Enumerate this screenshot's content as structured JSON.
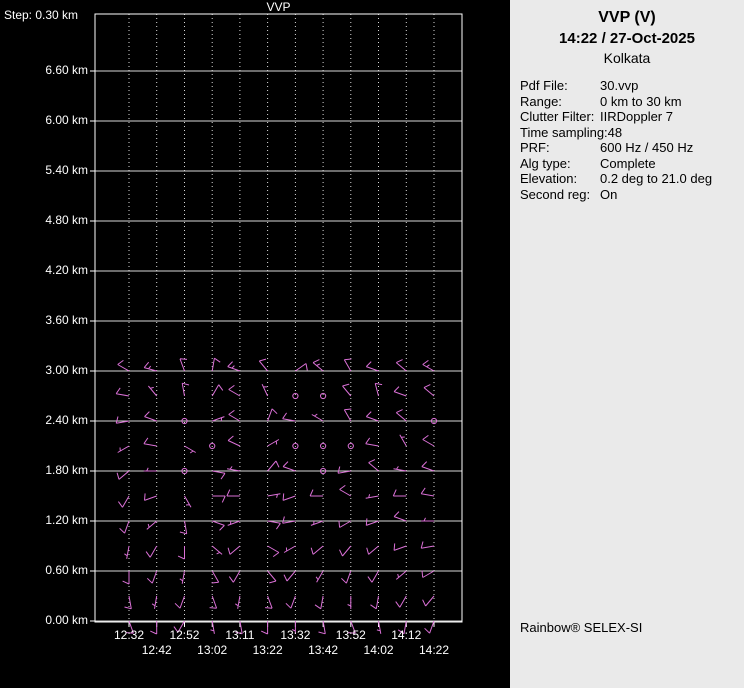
{
  "colors": {
    "background": "#000000",
    "grid": "#d9d9d9",
    "border": "#ffffff",
    "barbs": "#da70d6",
    "panel_bg": "#eaeaea",
    "chart_text": "#ffffff",
    "panel_text": "#000000"
  },
  "panel": {
    "title": "VVP (V)",
    "datetime": "14:22 / 27-Oct-2025",
    "site": "Kolkata",
    "fields": [
      {
        "label": "Pdf File:",
        "value": "30.vvp"
      },
      {
        "label": "Range:",
        "value": "0 km to 30 km"
      },
      {
        "label": "Clutter Filter:",
        "value": "IIRDoppler 7"
      },
      {
        "label": "Time sampling:",
        "value": "48"
      },
      {
        "label": "PRF:",
        "value": "600 Hz / 450 Hz"
      },
      {
        "label": "Alg type:",
        "value": "Complete"
      },
      {
        "label": "Elevation:",
        "value": "0.2 deg to 21.0 deg"
      },
      {
        "label": "Second reg:",
        "value": "On"
      }
    ],
    "footer": "Rainbow® SELEX-SI"
  },
  "chart_data": {
    "type": "wind-barb-time-height",
    "title": "VVP",
    "step_label": "Step: 0.30 km",
    "x_ticks": [
      "12:32",
      "12:42",
      "12:52",
      "13:02",
      "13:11",
      "13:22",
      "13:32",
      "13:42",
      "13:52",
      "14:02",
      "14:12",
      "14:22"
    ],
    "y_ticks_km": [
      6.6,
      6.0,
      5.4,
      4.8,
      4.2,
      3.6,
      3.0,
      2.4,
      1.8,
      1.2,
      0.6,
      0.0
    ],
    "y_tick_labels": [
      "6.60 km",
      "6.00 km",
      "5.40 km",
      "4.80 km",
      "4.20 km",
      "3.60 km",
      "3.00 km",
      "2.40 km",
      "1.80 km",
      "1.20 km",
      "0.60 km",
      "0.00 km"
    ],
    "y_unit": "km",
    "ylim_km": [
      0.0,
      7.3
    ],
    "grid": {
      "horizontal": "solid",
      "vertical": "dotted"
    },
    "barb_color": "#da70d6",
    "barb_units": "kt",
    "barb_note": "each barb = [wind_direction_deg_from, wind_speed_kt]; [0,0] = calm (circle)",
    "series": [
      {
        "height_km": 3.0,
        "barbs": [
          [
            300,
            10
          ],
          [
            285,
            15
          ],
          [
            340,
            10
          ],
          [
            10,
            10
          ],
          [
            290,
            15
          ],
          [
            320,
            10
          ],
          [
            55,
            10
          ],
          [
            310,
            15
          ],
          [
            330,
            10
          ],
          [
            290,
            10
          ],
          [
            310,
            10
          ],
          [
            300,
            15
          ]
        ]
      },
      {
        "height_km": 2.7,
        "barbs": [
          [
            280,
            10
          ],
          [
            320,
            5
          ],
          [
            350,
            10
          ],
          [
            30,
            10
          ],
          [
            300,
            10
          ],
          [
            335,
            5
          ],
          [
            0,
            0
          ],
          [
            0,
            0
          ],
          [
            320,
            10
          ],
          [
            345,
            10
          ],
          [
            290,
            10
          ],
          [
            310,
            10
          ]
        ]
      },
      {
        "height_km": 2.4,
        "barbs": [
          [
            260,
            10
          ],
          [
            290,
            10
          ],
          [
            0,
            0
          ],
          [
            70,
            5
          ],
          [
            300,
            10
          ],
          [
            20,
            10
          ],
          [
            280,
            10
          ],
          [
            300,
            5
          ],
          [
            330,
            10
          ],
          [
            290,
            10
          ],
          [
            310,
            10
          ],
          [
            0,
            0
          ]
        ]
      },
      {
        "height_km": 2.1,
        "barbs": [
          [
            240,
            5
          ],
          [
            280,
            10
          ],
          [
            120,
            5
          ],
          [
            0,
            0
          ],
          [
            295,
            10
          ],
          [
            60,
            5
          ],
          [
            0,
            0
          ],
          [
            0,
            0
          ],
          [
            0,
            0
          ],
          [
            280,
            10
          ],
          [
            330,
            5
          ],
          [
            300,
            10
          ]
        ]
      },
      {
        "height_km": 1.8,
        "barbs": [
          [
            230,
            10
          ],
          [
            270,
            5
          ],
          [
            0,
            0
          ],
          [
            100,
            10
          ],
          [
            280,
            5
          ],
          [
            40,
            10
          ],
          [
            290,
            10
          ],
          [
            0,
            0
          ],
          [
            260,
            10
          ],
          [
            310,
            10
          ],
          [
            280,
            5
          ],
          [
            290,
            10
          ]
        ]
      },
      {
        "height_km": 1.5,
        "barbs": [
          [
            210,
            10
          ],
          [
            250,
            10
          ],
          [
            150,
            5
          ],
          [
            90,
            10
          ],
          [
            270,
            10
          ],
          [
            80,
            5
          ],
          [
            250,
            10
          ],
          [
            270,
            10
          ],
          [
            300,
            10
          ],
          [
            260,
            5
          ],
          [
            270,
            10
          ],
          [
            280,
            10
          ]
        ]
      },
      {
        "height_km": 1.2,
        "barbs": [
          [
            200,
            10
          ],
          [
            230,
            5
          ],
          [
            170,
            10
          ],
          [
            110,
            10
          ],
          [
            250,
            5
          ],
          [
            100,
            10
          ],
          [
            260,
            10
          ],
          [
            250,
            5
          ],
          [
            240,
            10
          ],
          [
            250,
            10
          ],
          [
            290,
            10
          ],
          [
            270,
            5
          ]
        ]
      },
      {
        "height_km": 0.9,
        "barbs": [
          [
            190,
            5
          ],
          [
            210,
            10
          ],
          [
            180,
            10
          ],
          [
            130,
            5
          ],
          [
            230,
            10
          ],
          [
            120,
            10
          ],
          [
            240,
            5
          ],
          [
            230,
            10
          ],
          [
            220,
            10
          ],
          [
            230,
            10
          ],
          [
            250,
            10
          ],
          [
            260,
            10
          ]
        ]
      },
      {
        "height_km": 0.6,
        "barbs": [
          [
            180,
            10
          ],
          [
            200,
            10
          ],
          [
            190,
            5
          ],
          [
            150,
            10
          ],
          [
            210,
            10
          ],
          [
            140,
            10
          ],
          [
            220,
            10
          ],
          [
            210,
            5
          ],
          [
            200,
            10
          ],
          [
            210,
            10
          ],
          [
            230,
            5
          ],
          [
            240,
            10
          ]
        ]
      },
      {
        "height_km": 0.3,
        "barbs": [
          [
            170,
            10
          ],
          [
            190,
            5
          ],
          [
            200,
            10
          ],
          [
            160,
            10
          ],
          [
            190,
            5
          ],
          [
            160,
            10
          ],
          [
            200,
            10
          ],
          [
            190,
            10
          ],
          [
            180,
            5
          ],
          [
            190,
            10
          ],
          [
            210,
            10
          ],
          [
            220,
            10
          ]
        ]
      },
      {
        "height_km": 0.0,
        "barbs": [
          [
            160,
            10
          ],
          [
            180,
            10
          ],
          [
            210,
            10
          ],
          [
            170,
            5
          ],
          [
            170,
            10
          ],
          [
            180,
            10
          ],
          [
            180,
            5
          ],
          [
            170,
            10
          ],
          [
            160,
            10
          ],
          [
            170,
            5
          ],
          [
            190,
            10
          ],
          [
            200,
            10
          ]
        ]
      }
    ]
  }
}
